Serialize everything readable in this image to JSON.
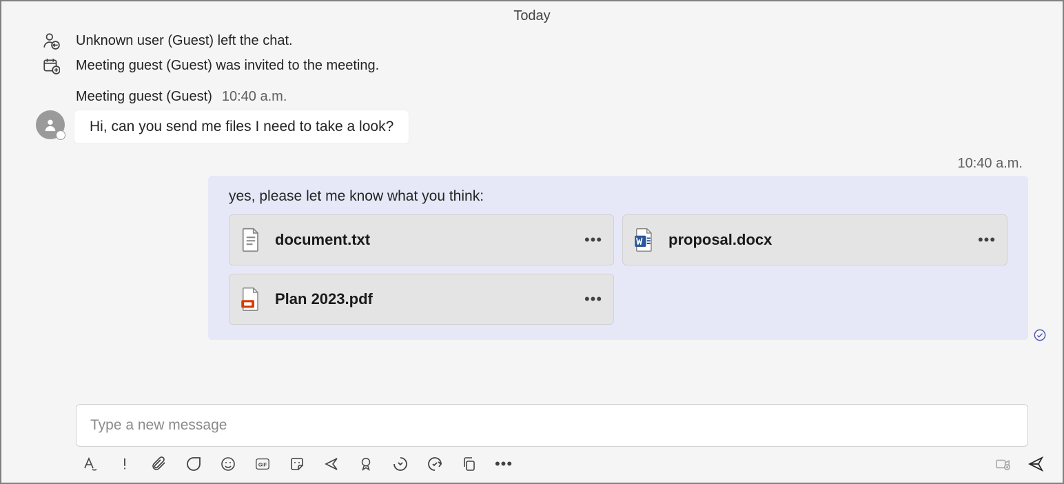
{
  "date_separator": "Today",
  "system_events": [
    {
      "icon": "person-left-icon",
      "text": "Unknown user (Guest) left the chat."
    },
    {
      "icon": "meeting-invite-icon",
      "text": "Meeting guest (Guest) was invited to the meeting."
    }
  ],
  "incoming": {
    "sender": "Meeting guest (Guest)",
    "time": "10:40 a.m.",
    "text": "Hi, can you send me files I need to take a look?"
  },
  "outgoing": {
    "time": "10:40 a.m.",
    "text": "yes, please let me know what you think:",
    "files": [
      {
        "name": "document.txt",
        "type": "txt"
      },
      {
        "name": "proposal.docx",
        "type": "word"
      },
      {
        "name": "Plan 2023.pdf",
        "type": "pdf"
      }
    ]
  },
  "composer": {
    "placeholder": "Type a new message"
  },
  "colors": {
    "out_bubble": "#e6e8f7",
    "file_card": "#e4e4e4",
    "accent": "#4f52b2",
    "word_blue": "#2b579a",
    "pdf_red": "#d83b01"
  }
}
